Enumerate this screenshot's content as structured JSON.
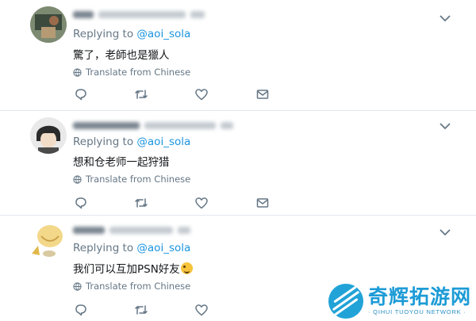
{
  "colors": {
    "link": "#1b95e0",
    "muted": "#657786",
    "text": "#14171a",
    "divider": "#e1e8ed",
    "watermark": "#1d9bd6"
  },
  "icons": {
    "caret": "chevron-down-icon",
    "globe": "globe-icon",
    "reply": "reply-icon",
    "retweet": "retweet-icon",
    "like": "heart-icon",
    "dm": "envelope-icon"
  },
  "tweets": [
    {
      "replying_prefix": "Replying to ",
      "replying_handle": "@aoi_sola",
      "text": "驚了，老師也是獵人",
      "translate": "Translate from Chinese"
    },
    {
      "replying_prefix": "Replying to ",
      "replying_handle": "@aoi_sola",
      "text": "想和仓老师一起狩猎",
      "translate": "Translate from Chinese"
    },
    {
      "replying_prefix": "Replying to ",
      "replying_handle": "@aoi_sola",
      "text": "我们可以互加PSN好友",
      "translate": "Translate from Chinese"
    }
  ],
  "watermark": {
    "cn": "奇辉拓游网",
    "en": "· QIHUI TUOYOU NETWORK ·"
  }
}
